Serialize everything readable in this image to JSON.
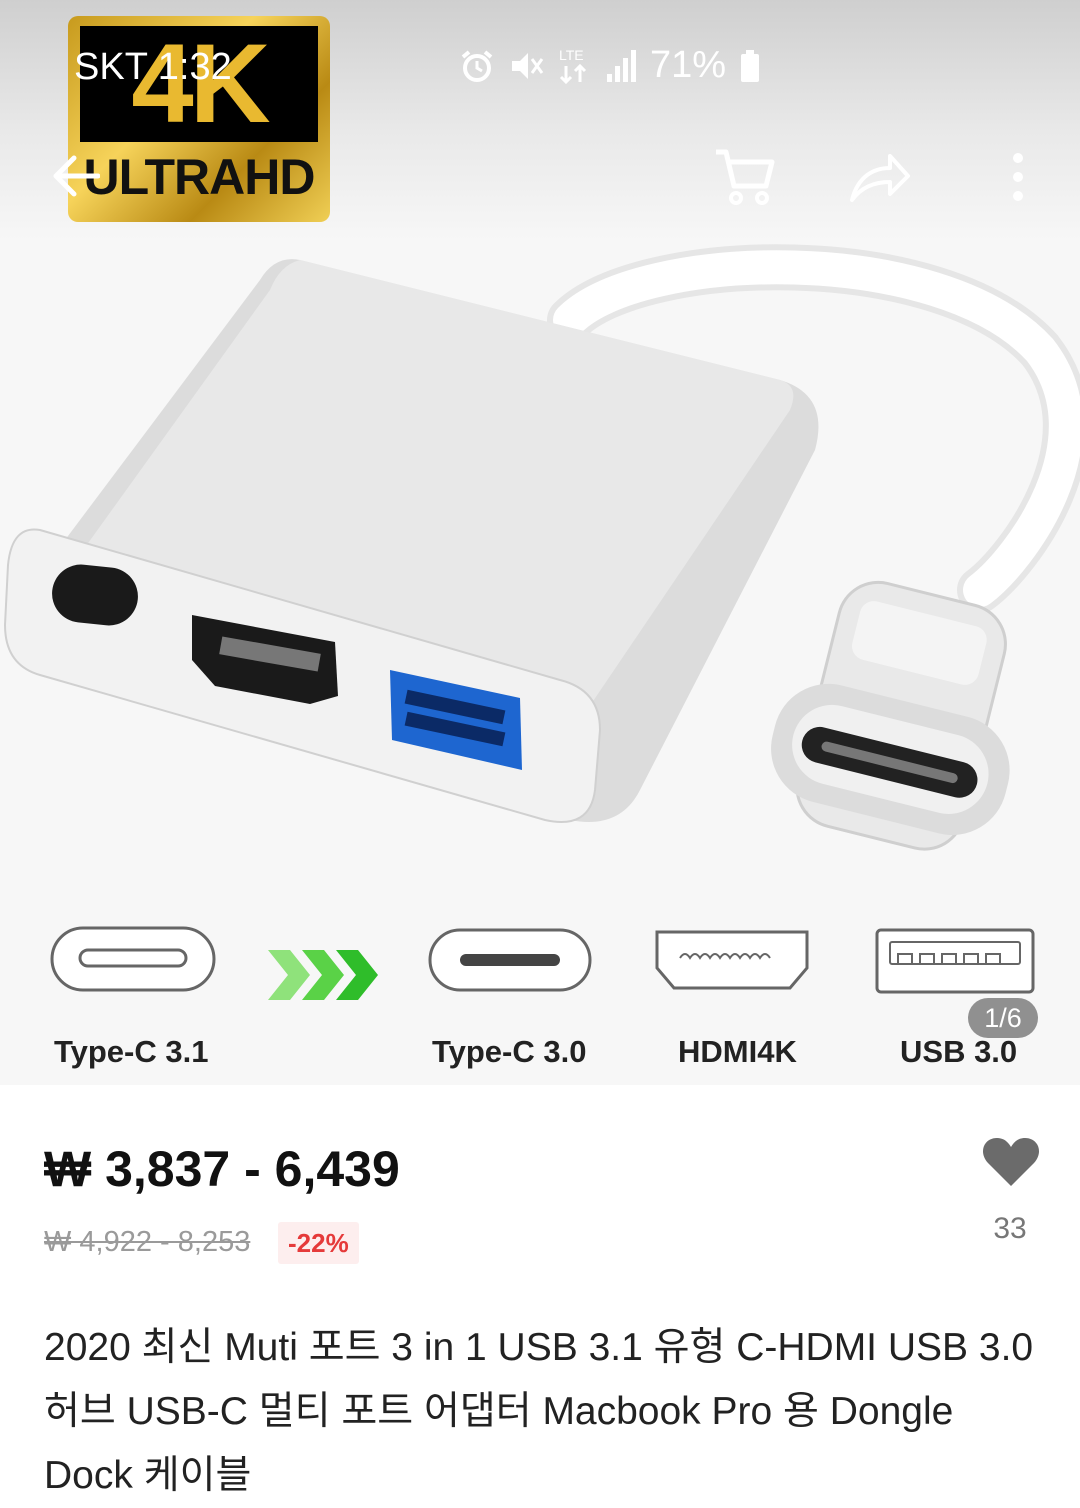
{
  "status_bar": {
    "carrier_time": "SKT 1:32",
    "network": "LTE",
    "battery": "71%"
  },
  "toolbar": {
    "back_icon": "back-arrow-icon",
    "cart_icon": "cart-icon",
    "share_icon": "share-icon",
    "more_icon": "more-vertical-icon"
  },
  "image_badge": {
    "big": "4K",
    "small": "ULTRAHD"
  },
  "ports": {
    "labels": [
      "Type-C 3.1",
      "Type-C 3.0",
      "HDMI4K",
      "USB 3.0"
    ]
  },
  "gallery": {
    "counter": "1/6"
  },
  "product": {
    "price": "₩ 3,837 - 6,439",
    "original_price": "₩ 4,922 - 8,253",
    "discount": "-22%",
    "favorites": "33",
    "title": "2020 최신 Muti 포트 3 in 1 USB 3.1 유형 C-HDMI USB 3.0 허브 USB-C 멀티 포트 어댑터 Macbook Pro 용 Dongle Dock 케이블"
  },
  "colors": {
    "accent_green": "#41c43a",
    "discount_red": "#e53a3a",
    "badge_gold": "#e9b930"
  }
}
